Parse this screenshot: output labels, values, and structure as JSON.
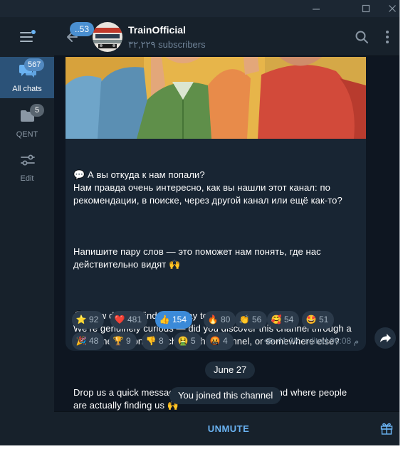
{
  "window": {
    "controls": [
      "minimize",
      "maximize",
      "close"
    ]
  },
  "sidebar": {
    "folders": [
      {
        "label": "All chats",
        "badge": "567",
        "active": true,
        "icon": "chat-bubbles-icon"
      },
      {
        "label": "QENT",
        "badge": "5",
        "active": false,
        "icon": "folder-icon"
      },
      {
        "label": "Edit",
        "badge": "",
        "active": false,
        "icon": "sliders-icon"
      }
    ]
  },
  "header": {
    "back_badge": "..53",
    "title": "TrainOfficial",
    "subscribers": "۳۲,۲۲۹ subscribers"
  },
  "post": {
    "paragraphs": [
      [
        "💬 А вы откуда к нам попали?",
        "Нам правда очень интересно, как вы нашли этот канал: по",
        "рекомендации, в поиске, через другой канал или ещё как-то?"
      ],
      [
        "Напишите пару слов — это поможет нам понять, где нас",
        "действительно видят 🙌"
      ],
      [
        "💬 How did you find your way to us?",
        "We’re genuinely curious — did you discover this channel through a",
        "recommendation, search, another channel, or somewhere else?"
      ],
      [
        "Drop us a quick message — it’ll help us understand where people",
        "are actually finding us 🙌"
      ]
    ],
    "reactions": [
      {
        "emoji": "⭐",
        "count": "92",
        "chosen": false,
        "color": "#f2b630"
      },
      {
        "emoji": "❤️",
        "count": "481",
        "chosen": false,
        "color": "#e0364c"
      },
      {
        "emoji": "👍",
        "count": "154",
        "chosen": true,
        "color": "#f7c444"
      },
      {
        "emoji": "🔥",
        "count": "80",
        "chosen": false,
        "color": "#f4743b"
      },
      {
        "emoji": "👏",
        "count": "56",
        "chosen": false,
        "color": "#f7c444"
      },
      {
        "emoji": "🥰",
        "count": "54",
        "chosen": false,
        "color": "#f7c444"
      },
      {
        "emoji": "🤩",
        "count": "51",
        "chosen": false,
        "color": "#f7c444"
      },
      {
        "emoji": "🎉",
        "count": "48",
        "chosen": false,
        "color": "#e86fa3"
      },
      {
        "emoji": "🏆",
        "count": "9",
        "chosen": false,
        "color": "#e0a232"
      },
      {
        "emoji": "👎",
        "count": "8",
        "chosen": false,
        "color": "#f7c444"
      },
      {
        "emoji": "🤮",
        "count": "5",
        "chosen": false,
        "color": "#7bc043"
      },
      {
        "emoji": "🤬",
        "count": "4",
        "chosen": false,
        "color": "#d8412f"
      }
    ],
    "views": "41.2K",
    "edited_time": "edited 06:08 م"
  },
  "service_messages": {
    "date": "June 27",
    "joined": "You joined this channel"
  },
  "bottom": {
    "unmute_label": "UNMUTE"
  }
}
